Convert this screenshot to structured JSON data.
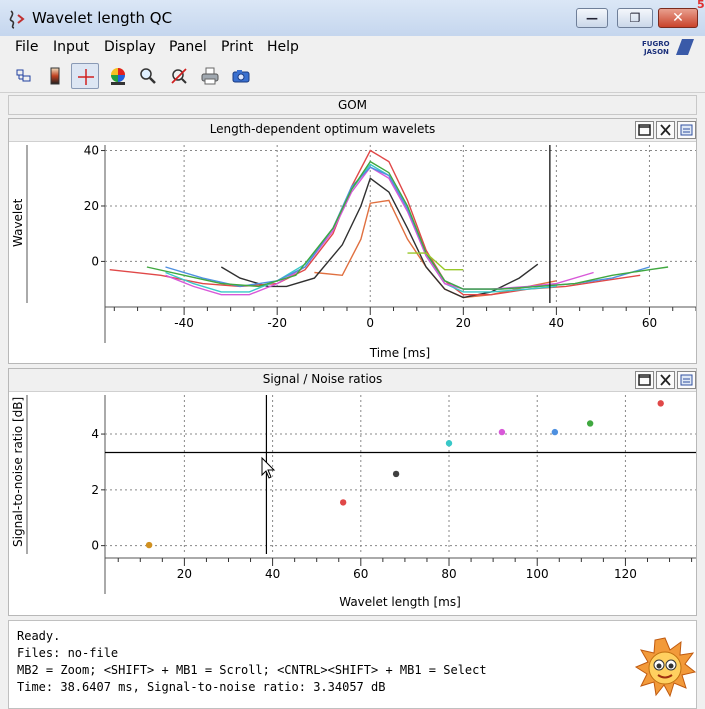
{
  "window": {
    "title": "Wavelet length QC",
    "minimize": "—",
    "maximize": "❐",
    "close": "✕",
    "corner_mark": "5"
  },
  "menu": [
    "File",
    "Input",
    "Display",
    "Panel",
    "Print",
    "Help"
  ],
  "logo_text": [
    "FUGRO",
    "JASON"
  ],
  "toolbar_icons": [
    "layout-icon",
    "colorbar-icon",
    "crosshair-icon",
    "palette-icon",
    "zoom-icon",
    "no-zoom-icon",
    "printer-icon",
    "camera-icon"
  ],
  "gom_label": "GOM",
  "wavelet_panel": {
    "title": "Length-dependent optimum wavelets",
    "ylabel": "Wavelet",
    "xlabel": "Time [ms]"
  },
  "snr_panel": {
    "title": "Signal / Noise ratios",
    "ylabel": "Signal-to-noise ratio [dB]",
    "xlabel": "Wavelet length [ms]"
  },
  "status": {
    "line1": "Ready.",
    "line2": "Files: no-file",
    "line3": "MB2 = Zoom; <SHIFT> + MB1 = Scroll; <CNTRL><SHIFT> + MB1 = Select",
    "line4": "Time: 38.6407 ms, Signal-to-noise ratio: 3.34057 dB"
  },
  "chart_data": [
    {
      "type": "line",
      "title": "Length-dependent optimum wavelets",
      "xlabel": "Time [ms]",
      "ylabel": "Wavelet",
      "xlim": [
        -57,
        70
      ],
      "ylim": [
        -15,
        42
      ],
      "xticks": [
        -40,
        -20,
        0,
        20,
        40,
        60
      ],
      "yticks": [
        0,
        20,
        40
      ],
      "cursor_x": 38.6,
      "grid": true,
      "series": [
        {
          "color": "#e07040",
          "points": [
            [
              -12,
              -4
            ],
            [
              -6,
              -5
            ],
            [
              -2,
              8
            ],
            [
              0,
              21
            ],
            [
              4,
              22
            ],
            [
              8,
              8
            ],
            [
              12,
              -2
            ],
            [
              16,
              -10
            ],
            [
              20,
              -13
            ],
            [
              26,
              -12
            ],
            [
              34,
              -9
            ],
            [
              40,
              -7
            ]
          ]
        },
        {
          "color": "#303030",
          "points": [
            [
              -32,
              -2
            ],
            [
              -28,
              -6
            ],
            [
              -22,
              -9
            ],
            [
              -18,
              -9
            ],
            [
              -12,
              -6
            ],
            [
              -6,
              6
            ],
            [
              -2,
              20
            ],
            [
              0,
              30
            ],
            [
              4,
              25
            ],
            [
              8,
              12
            ],
            [
              12,
              -2
            ],
            [
              16,
              -10
            ],
            [
              20,
              -13
            ],
            [
              26,
              -11
            ],
            [
              32,
              -6
            ],
            [
              36,
              -1
            ]
          ]
        },
        {
          "color": "#e04848",
          "points": [
            [
              -56,
              -3
            ],
            [
              -45,
              -5
            ],
            [
              -36,
              -8
            ],
            [
              -28,
              -9
            ],
            [
              -20,
              -8
            ],
            [
              -14,
              -3
            ],
            [
              -8,
              10
            ],
            [
              -4,
              27
            ],
            [
              0,
              40
            ],
            [
              4,
              36
            ],
            [
              8,
              22
            ],
            [
              12,
              4
            ],
            [
              16,
              -7
            ],
            [
              20,
              -12
            ],
            [
              26,
              -12
            ],
            [
              34,
              -10
            ],
            [
              42,
              -9
            ],
            [
              50,
              -7
            ],
            [
              58,
              -5
            ]
          ]
        },
        {
          "color": "#38c8c8",
          "points": [
            [
              -44,
              -4
            ],
            [
              -38,
              -8
            ],
            [
              -32,
              -11
            ],
            [
              -26,
              -11
            ],
            [
              -20,
              -7
            ],
            [
              -14,
              -1
            ],
            [
              -8,
              12
            ],
            [
              -4,
              26
            ],
            [
              0,
              35
            ],
            [
              4,
              31
            ],
            [
              8,
              19
            ],
            [
              12,
              2
            ],
            [
              16,
              -8
            ],
            [
              20,
              -11
            ],
            [
              26,
              -11
            ],
            [
              34,
              -10
            ],
            [
              40,
              -9
            ]
          ]
        },
        {
          "color": "#d858d8",
          "points": [
            [
              -44,
              -5
            ],
            [
              -38,
              -9
            ],
            [
              -32,
              -12
            ],
            [
              -26,
              -12
            ],
            [
              -20,
              -8
            ],
            [
              -14,
              -2
            ],
            [
              -8,
              11
            ],
            [
              -4,
              25
            ],
            [
              0,
              34
            ],
            [
              4,
              30
            ],
            [
              8,
              18
            ],
            [
              12,
              2
            ],
            [
              16,
              -8
            ],
            [
              20,
              -10
            ],
            [
              26,
              -10
            ],
            [
              34,
              -9
            ],
            [
              40,
              -8
            ],
            [
              48,
              -4
            ]
          ]
        },
        {
          "color": "#4e90e0",
          "points": [
            [
              -44,
              -2
            ],
            [
              -36,
              -6
            ],
            [
              -28,
              -9
            ],
            [
              -20,
              -7
            ],
            [
              -14,
              -2
            ],
            [
              -8,
              12
            ],
            [
              -4,
              27
            ],
            [
              0,
              34
            ],
            [
              4,
              31
            ],
            [
              8,
              19
            ],
            [
              12,
              3
            ],
            [
              16,
              -7
            ],
            [
              20,
              -10
            ],
            [
              28,
              -10
            ],
            [
              36,
              -9
            ],
            [
              44,
              -8
            ],
            [
              52,
              -6
            ],
            [
              60,
              -2
            ]
          ]
        },
        {
          "color": "#40a840",
          "points": [
            [
              -48,
              -2
            ],
            [
              -40,
              -5
            ],
            [
              -32,
              -8
            ],
            [
              -24,
              -9
            ],
            [
              -16,
              -5
            ],
            [
              -8,
              12
            ],
            [
              -4,
              26
            ],
            [
              0,
              36
            ],
            [
              4,
              32
            ],
            [
              8,
              20
            ],
            [
              12,
              3
            ],
            [
              16,
              -7
            ],
            [
              20,
              -10
            ],
            [
              28,
              -10
            ],
            [
              36,
              -9
            ],
            [
              44,
              -8
            ],
            [
              52,
              -5
            ],
            [
              60,
              -3
            ],
            [
              64,
              -2
            ]
          ]
        },
        {
          "color": "#98c828",
          "points": [
            [
              8,
              3
            ],
            [
              12,
              3
            ],
            [
              16,
              -3
            ],
            [
              20,
              -3
            ]
          ]
        }
      ]
    },
    {
      "type": "scatter",
      "title": "Signal / Noise ratios",
      "xlabel": "Wavelet length [ms]",
      "ylabel": "Signal-to-noise ratio [dB]",
      "xlim": [
        2,
        136
      ],
      "ylim": [
        -0.3,
        5.4
      ],
      "xticks": [
        20,
        40,
        60,
        80,
        100,
        120
      ],
      "yticks": [
        0,
        2,
        4
      ],
      "cursor_x": 38.6,
      "cursor_y": 3.34,
      "grid": true,
      "points": [
        {
          "x": 12,
          "y": 0.02,
          "color": "#d09020"
        },
        {
          "x": 56,
          "y": 1.55,
          "color": "#e04848"
        },
        {
          "x": 68,
          "y": 2.57,
          "color": "#404040"
        },
        {
          "x": 80,
          "y": 3.67,
          "color": "#38c8c8"
        },
        {
          "x": 92,
          "y": 4.07,
          "color": "#d858d8"
        },
        {
          "x": 104,
          "y": 4.07,
          "color": "#4e90e0"
        },
        {
          "x": 112,
          "y": 4.38,
          "color": "#40a840"
        },
        {
          "x": 128,
          "y": 5.1,
          "color": "#e04848"
        }
      ]
    }
  ]
}
